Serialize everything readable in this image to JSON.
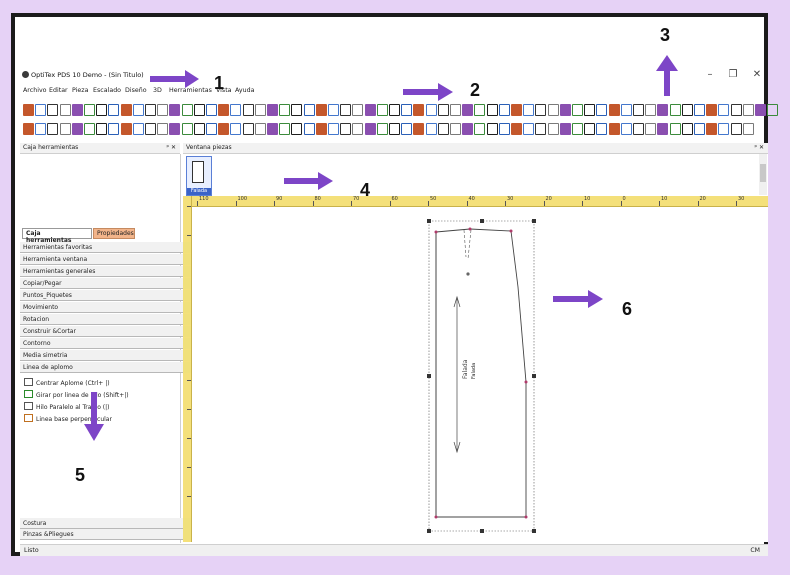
{
  "window": {
    "title": "OptiTex PDS 10 Demo - (Sin Titulo)",
    "controls": [
      "–",
      "❐",
      "✕"
    ]
  },
  "menu": [
    "Archivo",
    "Editar",
    "Pieza",
    "Escalado",
    "Diseño",
    "3D",
    "Herramientas",
    "Vista",
    "Ayuda"
  ],
  "panels": {
    "toolbox_title": "Caja herramientas",
    "pieces_title": "Ventana piezas",
    "pin_label": "ᵖ ✕"
  },
  "tabs": [
    "Caja herramientas",
    "Propiedades"
  ],
  "categories_top": [
    "Herramientas favoritas",
    "Herramienta ventana",
    "Herramientas generales",
    "Copiar/Pegar",
    "Puntos_Piquetes",
    "Movimiento",
    "Rotacion",
    "Construir &Cortar",
    "Contorno",
    "Media simetria",
    "Linea de aplomo"
  ],
  "commands": [
    "Centrar Aplome (Ctrl+ |)",
    "Girar por linea de hilo (Shift+|)",
    "Hilo Paralelo al Tramo (|)",
    "Linea base perpendicular"
  ],
  "categories_bottom": [
    "Costura",
    "Pinzas &Pliegues"
  ],
  "piece_thumb_label": "Falada",
  "piece_label": "Falada",
  "piece_label2": "Falada",
  "ruler_ticks": [
    "110",
    "100",
    "90",
    "80",
    "70",
    "60",
    "50",
    "40",
    "30",
    "20",
    "10",
    "0",
    "10",
    "20",
    "30"
  ],
  "status": {
    "left": "Listo",
    "right": "CM"
  },
  "callouts": [
    "1",
    "2",
    "3",
    "4",
    "5",
    "6"
  ],
  "colors": {
    "arrow": "#7d45c7",
    "background": "#e6d2f6",
    "ruler": "#f4e07a",
    "tab_active": "#f2b48a"
  }
}
